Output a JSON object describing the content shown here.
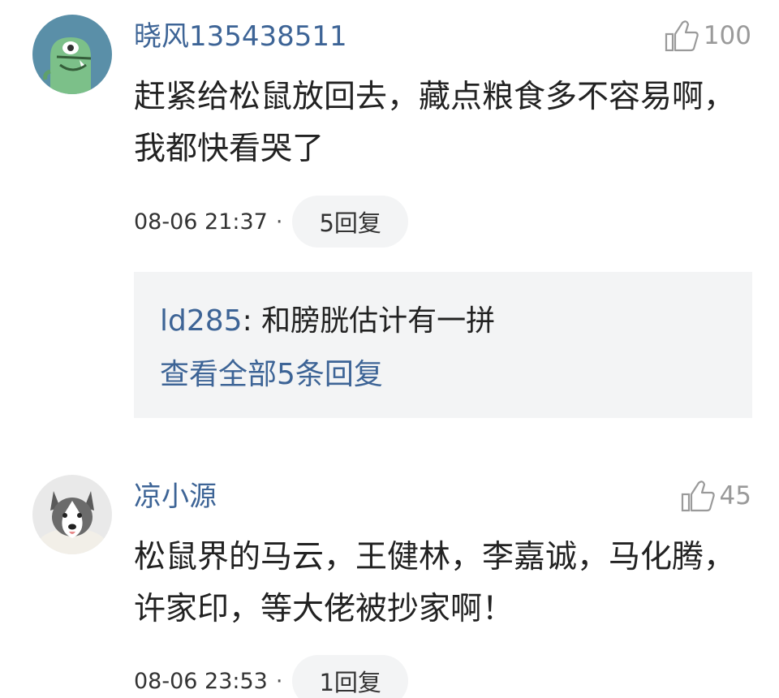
{
  "comments": [
    {
      "avatar": "monster-avatar",
      "username": "晓风135438511",
      "likes": "100",
      "text": "赶紧给松鼠放回去，藏点粮食多不容易啊，我都快看哭了",
      "time": "08-06 21:37",
      "separator": "·",
      "replies_label": "5回复",
      "featured_reply": {
        "user": "ld285",
        "colon": ": ",
        "text": "和膀胱估计有一拼"
      },
      "view_all_label": "查看全部5条回复"
    },
    {
      "avatar": "husky-dog-avatar",
      "username": "凉小源",
      "likes": "45",
      "text": "松鼠界的马云，王健林，李嘉诚，马化腾，许家印，等大佬被抄家啊！",
      "time": "08-06 23:53",
      "separator": "·",
      "replies_label": "1回复"
    }
  ],
  "colors": {
    "username": "#3d6496",
    "body_text": "#222222",
    "like_gray": "#9a9a9a",
    "pill_bg": "#f3f4f5",
    "reply_box_bg": "#f3f4f5"
  }
}
